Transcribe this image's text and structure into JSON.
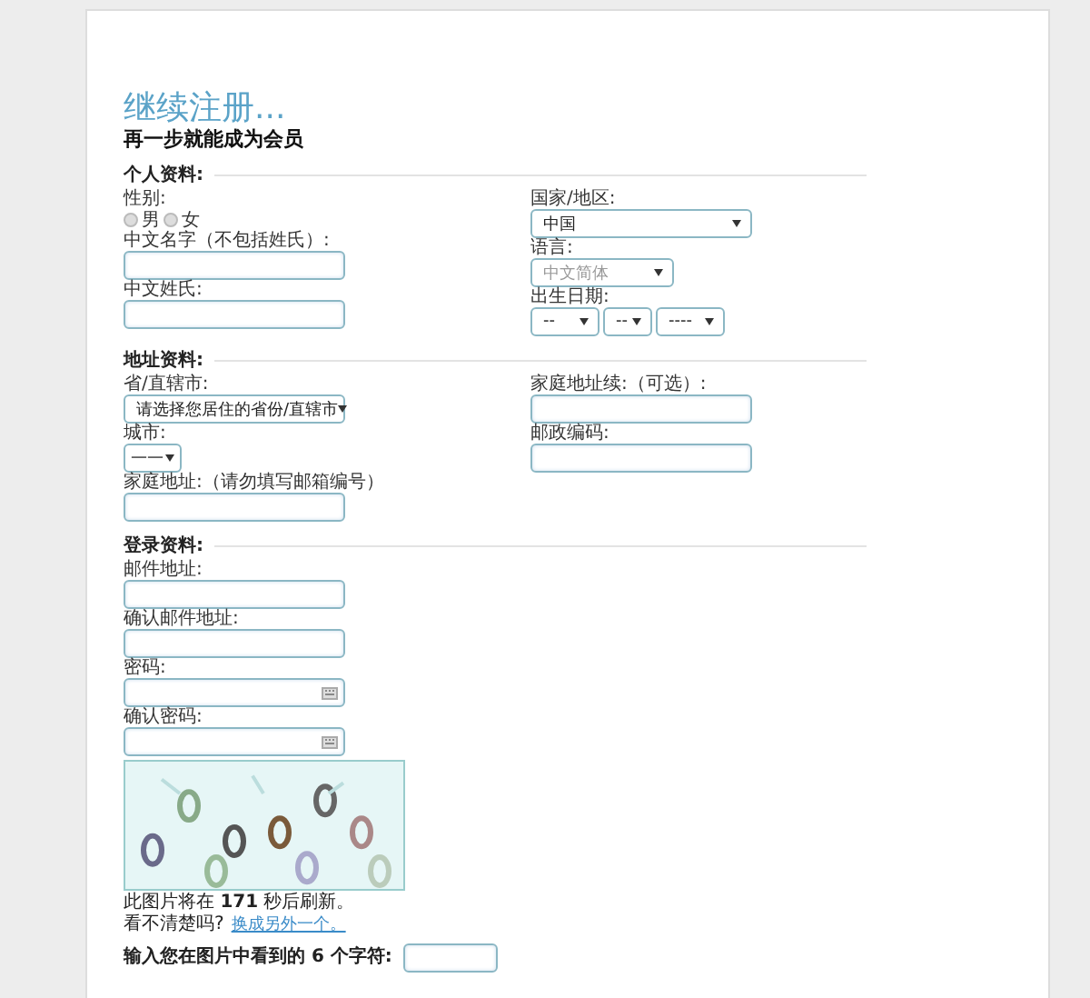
{
  "title": "继续注册...",
  "subtitle": "再一步就能成为会员",
  "sections": [
    {
      "heading": "个人资料:",
      "left": [
        {
          "kind": "radio",
          "label": "性别:",
          "options": [
            {
              "label": "男",
              "selected": false
            },
            {
              "label": "女",
              "selected": false
            }
          ]
        },
        {
          "kind": "text",
          "label": "中文名字（不包括姓氏）:"
        },
        {
          "kind": "text",
          "label": "中文姓氏:"
        }
      ],
      "right": [
        {
          "kind": "select",
          "label": "国家/地区:",
          "value": "中国",
          "disabled": false
        },
        {
          "kind": "select",
          "label": "语言:",
          "value": "中文简体",
          "disabled": true
        },
        {
          "kind": "date",
          "label": "出生日期:",
          "parts": [
            "--",
            "--",
            "----"
          ]
        }
      ]
    },
    {
      "heading": "地址资料:",
      "left": [
        {
          "kind": "select",
          "label": "省/直辖市:",
          "value": "请选择您居住的省份/直辖市",
          "disabled": false
        },
        {
          "kind": "select",
          "label": "城市:",
          "value": "——",
          "disabled": false
        },
        {
          "kind": "text",
          "label": "家庭地址:（请勿填写邮箱编号）"
        }
      ],
      "right": [
        {
          "kind": "text",
          "label": "家庭地址续:（可选）:"
        },
        {
          "kind": "text",
          "label": "邮政编码:"
        }
      ]
    },
    {
      "heading": "登录资料:",
      "left": [
        {
          "kind": "text",
          "label": "邮件地址:"
        },
        {
          "kind": "text",
          "label": "确认邮件地址:"
        },
        {
          "kind": "password",
          "label": "密码:"
        },
        {
          "kind": "password",
          "label": "确认密码:"
        }
      ]
    }
  ],
  "captcha": {
    "kind": "picture",
    "refresh_note": "此图片将在 **171** 秒后刷新。",
    "unclear": "看不清楚吗?",
    "change_link": "换成另外一个。",
    "prompt": "输入您在图片中看到的 6 个字符:"
  }
}
